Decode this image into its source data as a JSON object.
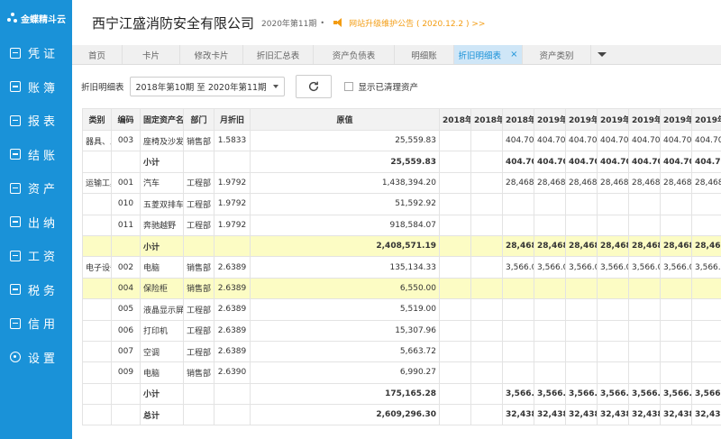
{
  "brand": {
    "name": "金蝶精斗云"
  },
  "sidebar": {
    "items": [
      {
        "label": "凭证",
        "icon": "document-edit-icon"
      },
      {
        "label": "账簿",
        "icon": "ledger-icon"
      },
      {
        "label": "报表",
        "icon": "report-icon"
      },
      {
        "label": "结账",
        "icon": "checkbox-icon"
      },
      {
        "label": "资产",
        "icon": "asset-icon"
      },
      {
        "label": "出纳",
        "icon": "cashier-icon"
      },
      {
        "label": "工资",
        "icon": "salary-icon"
      },
      {
        "label": "税务",
        "icon": "tax-icon"
      },
      {
        "label": "信用",
        "icon": "credit-icon"
      },
      {
        "label": "设置",
        "icon": "gear-icon"
      }
    ]
  },
  "header": {
    "company": "西宁江盛消防安全有限公司",
    "period": "2020年第11期",
    "notice": "网站升级维护公告 ( 2020.12.2 ) >>"
  },
  "tabs": [
    {
      "label": "首页"
    },
    {
      "label": "卡片"
    },
    {
      "label": "修改卡片"
    },
    {
      "label": "折旧汇总表"
    },
    {
      "label": "资产负债表"
    },
    {
      "label": "明细账"
    },
    {
      "label": "折旧明细表",
      "active": true
    },
    {
      "label": "资产类别"
    }
  ],
  "toolbar": {
    "label": "折旧明细表",
    "period_range": "2018年第10期 至 2020年第11期",
    "show_cleared_label": "显示已清理资产"
  },
  "table": {
    "columns": [
      "类别",
      "编码",
      "固定资产名",
      "部门",
      "月折旧",
      "原值",
      "2018年",
      "2018年",
      "2018年",
      "2019年",
      "2019年",
      "2019年",
      "2019年",
      "2019年",
      "2019年"
    ],
    "rows": [
      {
        "type": "normal",
        "cells": [
          "器具、工",
          "003",
          "座椅及沙发",
          "销售部",
          "1.5833",
          "25,559.83",
          "",
          "",
          "404.70",
          "404.70",
          "404.70",
          "404.70",
          "404.70",
          "404.70",
          "404.70"
        ]
      },
      {
        "type": "subtotal",
        "cells": [
          "",
          "",
          "小计",
          "",
          "",
          "25,559.83",
          "",
          "",
          "404.70",
          "404.70",
          "404.70",
          "404.70",
          "404.70",
          "404.70",
          "404.70"
        ]
      },
      {
        "type": "normal",
        "cells": [
          "运输工具",
          "001",
          "汽车",
          "工程部",
          "1.9792",
          "1,438,394.20",
          "",
          "",
          "28,468.",
          "28,468.",
          "28,468.",
          "28,468.",
          "28,468.",
          "28,468.",
          "28,468."
        ]
      },
      {
        "type": "normal",
        "cells": [
          "",
          "010",
          "五菱双排车",
          "工程部",
          "1.9792",
          "51,592.92",
          "",
          "",
          "",
          "",
          "",
          "",
          "",
          "",
          ""
        ]
      },
      {
        "type": "normal",
        "cells": [
          "",
          "011",
          "奔驰越野",
          "工程部",
          "1.9792",
          "918,584.07",
          "",
          "",
          "",
          "",
          "",
          "",
          "",
          "",
          ""
        ]
      },
      {
        "type": "subtotal-hl",
        "cells": [
          "",
          "",
          "小计",
          "",
          "",
          "2,408,571.19",
          "",
          "",
          "28,468",
          "28,468",
          "28,468",
          "28,468",
          "28,468",
          "28,468",
          "28,468"
        ]
      },
      {
        "type": "normal",
        "cells": [
          "电子设备",
          "002",
          "电脑",
          "销售部",
          "2.6389",
          "135,134.33",
          "",
          "",
          "3,566.0",
          "3,566.0",
          "3,566.0",
          "3,566.0",
          "3,566.0",
          "3,566.0",
          "3,566.0"
        ]
      },
      {
        "type": "hl",
        "cells": [
          "",
          "004",
          "保险柜",
          "销售部",
          "2.6389",
          "6,550.00",
          "",
          "",
          "",
          "",
          "",
          "",
          "",
          "",
          ""
        ]
      },
      {
        "type": "normal",
        "cells": [
          "",
          "005",
          "液晶显示屏",
          "工程部",
          "2.6389",
          "5,519.00",
          "",
          "",
          "",
          "",
          "",
          "",
          "",
          "",
          ""
        ]
      },
      {
        "type": "normal",
        "cells": [
          "",
          "006",
          "打印机",
          "工程部",
          "2.6389",
          "15,307.96",
          "",
          "",
          "",
          "",
          "",
          "",
          "",
          "",
          ""
        ]
      },
      {
        "type": "normal",
        "cells": [
          "",
          "007",
          "空调",
          "工程部",
          "2.6389",
          "5,663.72",
          "",
          "",
          "",
          "",
          "",
          "",
          "",
          "",
          ""
        ]
      },
      {
        "type": "normal",
        "cells": [
          "",
          "009",
          "电脑",
          "销售部",
          "2.6390",
          "6,990.27",
          "",
          "",
          "",
          "",
          "",
          "",
          "",
          "",
          ""
        ]
      },
      {
        "type": "subtotal",
        "cells": [
          "",
          "",
          "小计",
          "",
          "",
          "175,165.28",
          "",
          "",
          "3,566.0",
          "3,566.0",
          "3,566.0",
          "3,566.0",
          "3,566.0",
          "3,566.0",
          "3,566.0"
        ]
      },
      {
        "type": "subtotal",
        "cells": [
          "",
          "",
          "总计",
          "",
          "",
          "2,609,296.30",
          "",
          "",
          "32,438",
          "32,438",
          "32,438",
          "32,438",
          "32,438",
          "32,438",
          "32,438"
        ]
      }
    ]
  },
  "colors": {
    "sidebar": "#1a92d8",
    "active_tab_bg": "#cfe6f7",
    "highlight_row": "#fcfcc4",
    "notice": "#f39c12"
  }
}
